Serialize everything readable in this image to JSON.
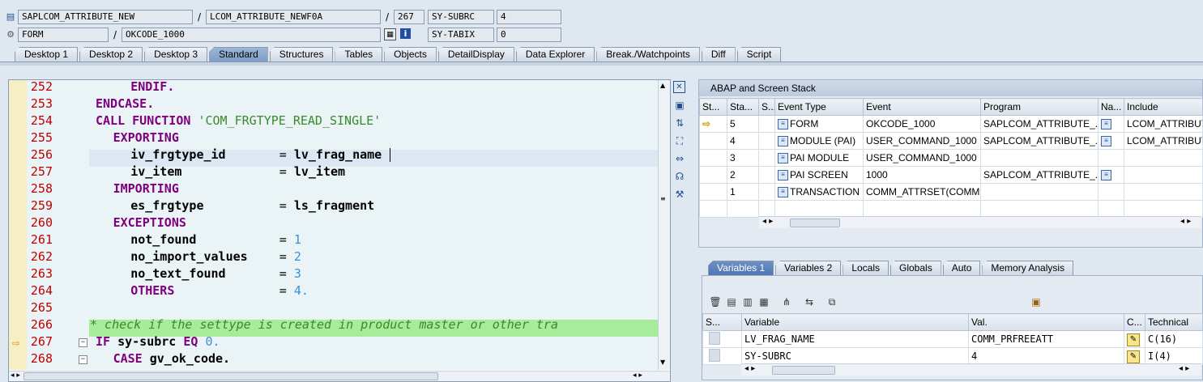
{
  "header": {
    "row1": {
      "program": "SAPLCOM_ATTRIBUTE_NEW",
      "include": "LCOM_ATTRIBUTE_NEWF0A",
      "line": "267",
      "sysvar": "SY-SUBRC",
      "sysval": "4"
    },
    "row2": {
      "event_type": "FORM",
      "event": "OKCODE_1000",
      "sysvar": "SY-TABIX",
      "sysval": "0"
    },
    "separator": "/"
  },
  "tabs": [
    "Desktop 1",
    "Desktop 2",
    "Desktop 3",
    "Standard",
    "Structures",
    "Tables",
    "Objects",
    "DetailDisplay",
    "Data Explorer",
    "Break./Watchpoints",
    "Diff",
    "Script"
  ],
  "active_tab": "Standard",
  "code": [
    {
      "num": "252",
      "text": "ENDIF.",
      "indent": 4
    },
    {
      "num": "253",
      "text": "ENDCASE.",
      "indent": 2
    },
    {
      "num": "254",
      "kw": "CALL FUNCTION ",
      "str": "'COM_FRGTYPE_READ_SINGLE'",
      "indent": 2
    },
    {
      "num": "255",
      "text": "EXPORTING",
      "indent": 3
    },
    {
      "num": "256",
      "left": "iv_frgtype_id",
      "right": "lv_frag_name",
      "indent": 4
    },
    {
      "num": "257",
      "left": "iv_item",
      "right": "lv_item",
      "indent": 4
    },
    {
      "num": "258",
      "text": "IMPORTING",
      "indent": 3
    },
    {
      "num": "259",
      "left": "es_frgtype",
      "right": "ls_fragment",
      "indent": 4
    },
    {
      "num": "260",
      "text": "EXCEPTIONS",
      "indent": 3
    },
    {
      "num": "261",
      "left": "not_found",
      "numv": "1",
      "indent": 4
    },
    {
      "num": "262",
      "left": "no_import_values",
      "numv": "2",
      "indent": 4
    },
    {
      "num": "263",
      "left": "no_text_found",
      "numv": "3",
      "indent": 4
    },
    {
      "num": "264",
      "left": "OTHERS",
      "numv": "4.",
      "indent": 4
    },
    {
      "num": "265",
      "text": "",
      "indent": 0
    },
    {
      "num": "266",
      "comment": "* check if the settype is created in product master or other tra"
    },
    {
      "num": "267",
      "if_kw": "IF ",
      "if_var": "sy-subrc ",
      "if_eq": "EQ ",
      "if_num": "0.",
      "indent": 2
    },
    {
      "num": "268",
      "case_kw": "CASE ",
      "case_var": "gv_ok_code.",
      "indent": 3
    }
  ],
  "stack": {
    "title": "ABAP and Screen Stack",
    "columns": [
      "St...",
      "Sta...",
      "S...",
      "Event Type",
      "Event",
      "Program",
      "Na...",
      "Include"
    ],
    "rows": [
      {
        "level": "5",
        "type": "FORM",
        "event": "OKCODE_1000",
        "program": "SAPLCOM_ATTRIBUTE_...",
        "include": "LCOM_ATTRIBUT"
      },
      {
        "level": "4",
        "type": "MODULE (PAI)",
        "event": "USER_COMMAND_1000",
        "program": "SAPLCOM_ATTRIBUTE_...",
        "include": "LCOM_ATTRIBUT"
      },
      {
        "level": "3",
        "type": "PAI MODULE",
        "event": "USER_COMMAND_1000",
        "program": "",
        "include": ""
      },
      {
        "level": "2",
        "type": "PAI SCREEN",
        "event": "1000",
        "program": "SAPLCOM_ATTRIBUTE_...",
        "include": ""
      },
      {
        "level": "1",
        "type": "TRANSACTION",
        "event": "COMM_ATTRSET(COMM...",
        "program": "",
        "include": ""
      }
    ]
  },
  "var_tabs": [
    "Variables 1",
    "Variables 2",
    "Locals",
    "Globals",
    "Auto",
    "Memory Analysis"
  ],
  "active_var_tab": "Variables 1",
  "variables": {
    "columns": [
      "S...",
      "Variable",
      "Val.",
      "C...",
      "Technical"
    ],
    "rows": [
      {
        "name": "LV_FRAG_NAME",
        "value": "COMM_PRFREEATT",
        "tech": "C(16)"
      },
      {
        "name": "SY-SUBRC",
        "value": "4",
        "tech": "I(4)"
      }
    ]
  }
}
